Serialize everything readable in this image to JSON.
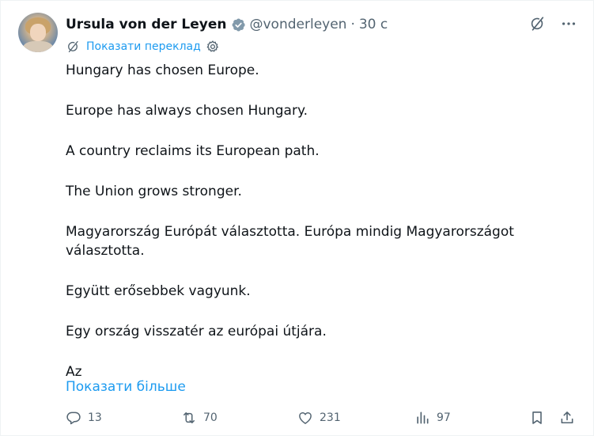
{
  "author": {
    "name": "Ursula von der Leyen",
    "handle": "@vonderleyen",
    "separator": "·",
    "time": "30 с",
    "avatar_icon": "profile-photo",
    "verified_icon": "verified-badge-icon",
    "verified_color": "#829aab"
  },
  "top_icons": [
    "grok-icon",
    "more-icon"
  ],
  "translate": {
    "label": "Показати переклад",
    "icon": "translate-icon",
    "settings_icon": "gear-icon",
    "color": "#1d9bf0"
  },
  "tweet_text": [
    "Hungary has chosen Europe.",
    "Europe has always chosen Hungary.",
    "A country reclaims its European path.",
    "The Union grows stronger.",
    "Magyarország Európát választotta. Európa mindig Magyarországot választotta.",
    "Együtt erősebbek vagyunk.",
    "Egy ország visszatér az európai útjára.",
    "Az"
  ],
  "show_more": "Показати більше",
  "actions": {
    "replies": "13",
    "reposts": "70",
    "likes": "231",
    "views": "97"
  },
  "colors": {
    "text": "#0f1419",
    "secondary": "#536471",
    "link": "#1d9bf0"
  }
}
